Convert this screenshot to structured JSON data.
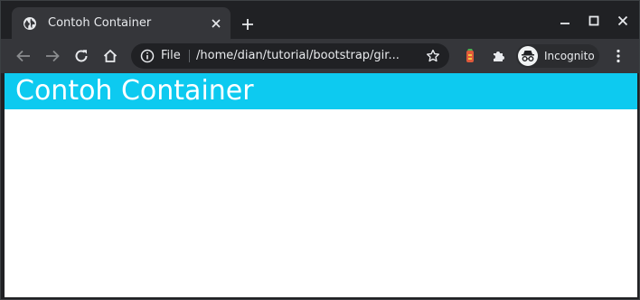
{
  "tab": {
    "title": "Contoh Container",
    "favicon": "globe-icon"
  },
  "window_controls": {
    "minimize": "minimize-icon",
    "maximize": "maximize-icon",
    "close": "close-icon"
  },
  "toolbar": {
    "back": "arrow-left-icon",
    "forward": "arrow-right-icon",
    "reload": "reload-icon",
    "home": "home-icon",
    "menu": "kebab-menu-icon"
  },
  "omnibox": {
    "scheme_label": "File",
    "url": "/home/dian/tutorial/bootstrap/gir...",
    "info_icon": "info-icon",
    "bookmark_icon": "star-icon"
  },
  "extensions": [
    "tomato-extension-icon",
    "puzzle-icon"
  ],
  "profile": {
    "label": "Incognito",
    "icon": "incognito-icon"
  },
  "page": {
    "heading": "Contoh Container",
    "banner_color": "#0dcaf0",
    "heading_color": "#ffffff"
  },
  "colors": {
    "frame": "#202124",
    "toolbar": "#35363a",
    "accent": "#0dcaf0"
  }
}
